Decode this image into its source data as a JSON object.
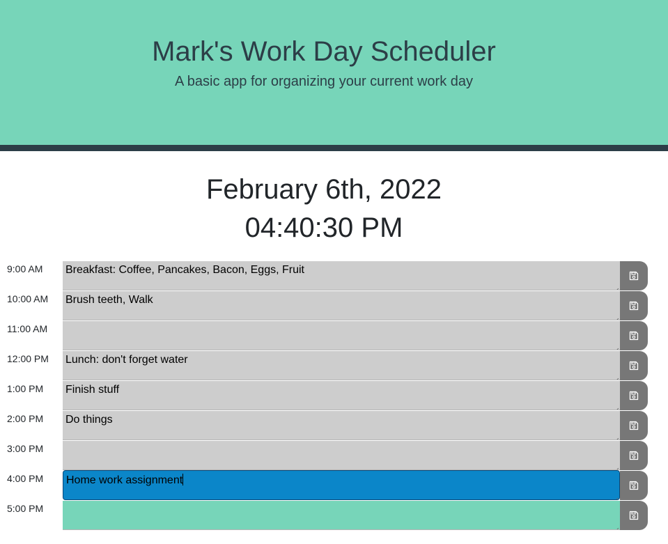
{
  "header": {
    "title": "Mark's Work Day Scheduler",
    "subtitle": "A basic app for organizing your current work day"
  },
  "current": {
    "date": "February 6th, 2022",
    "time": "04:40:30 PM"
  },
  "colors": {
    "header_bg": "#77d5b9",
    "header_bar": "#2c3e47",
    "past": "#cdcdcd",
    "present": "#0b86c9",
    "future": "#77d5b9",
    "save_button": "#777777"
  },
  "schedule": [
    {
      "hour": "9:00 AM",
      "text": "Breakfast: Coffee, Pancakes, Bacon, Eggs, Fruit",
      "status": "past"
    },
    {
      "hour": "10:00 AM",
      "text": "Brush teeth, Walk",
      "status": "past"
    },
    {
      "hour": "11:00 AM",
      "text": "",
      "status": "past"
    },
    {
      "hour": "12:00 PM",
      "text": "Lunch: don't forget water",
      "status": "past"
    },
    {
      "hour": "1:00 PM",
      "text": "Finish stuff",
      "status": "past"
    },
    {
      "hour": "2:00 PM",
      "text": "Do things",
      "status": "past"
    },
    {
      "hour": "3:00 PM",
      "text": "",
      "status": "past"
    },
    {
      "hour": "4:00 PM",
      "text": "Home work assignment",
      "status": "present"
    },
    {
      "hour": "5:00 PM",
      "text": "",
      "status": "future"
    }
  ],
  "icons": {
    "save": "floppy-disk-icon"
  }
}
